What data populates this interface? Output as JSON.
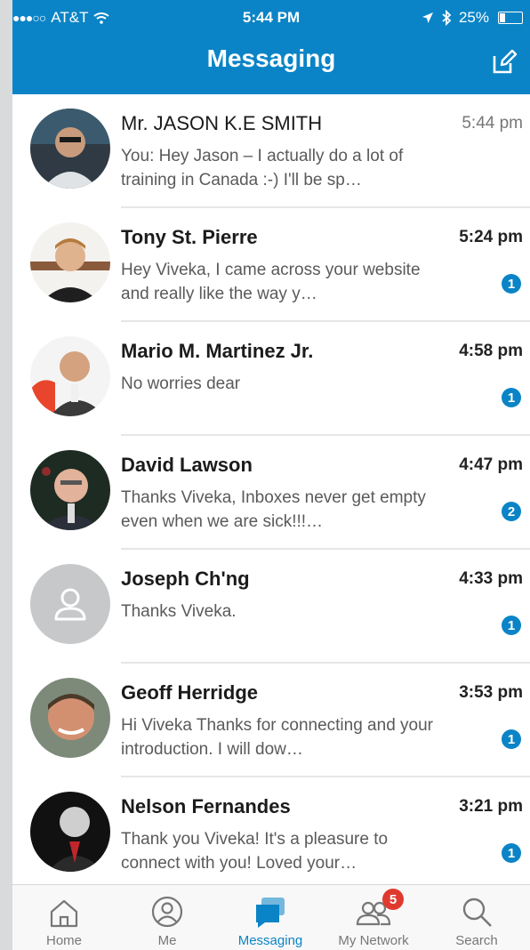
{
  "status_bar": {
    "carrier": "AT&T",
    "time": "5:44 PM",
    "battery": "25%"
  },
  "header": {
    "title": "Messaging"
  },
  "conversations": [
    {
      "name": "Mr. JASON K.E SMITH",
      "preview": "You: Hey Jason – I actually do a lot of training in Canada :-) I'll be sp…",
      "time": "5:44 pm",
      "unread": "",
      "avatar": "person-photo"
    },
    {
      "name": "Tony St. Pierre",
      "preview": "Hey Viveka, I came across your website and really like the way y…",
      "time": "5:24 pm",
      "unread": "1",
      "avatar": "person-photo"
    },
    {
      "name": "Mario M. Martinez Jr.",
      "preview": "No worries dear",
      "time": "4:58 pm",
      "unread": "1",
      "avatar": "person-photo"
    },
    {
      "name": "David Lawson",
      "preview": "Thanks Viveka,  Inboxes never get empty even when we are sick!!!…",
      "time": "4:47 pm",
      "unread": "2",
      "avatar": "person-photo"
    },
    {
      "name": "Joseph Ch'ng",
      "preview": "Thanks Viveka.",
      "time": "4:33 pm",
      "unread": "1",
      "avatar": "placeholder-person-icon"
    },
    {
      "name": "Geoff Herridge",
      "preview": "Hi Viveka  Thanks for connecting and your introduction. I will dow…",
      "time": "3:53 pm",
      "unread": "1",
      "avatar": "person-photo"
    },
    {
      "name": "Nelson Fernandes",
      "preview": "Thank you Viveka!  It's a pleasure to connect with you! Loved your…",
      "time": "3:21 pm",
      "unread": "1",
      "avatar": "person-photo"
    }
  ],
  "tabbar": {
    "home": "Home",
    "me": "Me",
    "messaging": "Messaging",
    "network": "My Network",
    "network_badge": "5",
    "search": "Search"
  },
  "colors": {
    "accent": "#0a84c6",
    "badge_red": "#e03a2f"
  }
}
